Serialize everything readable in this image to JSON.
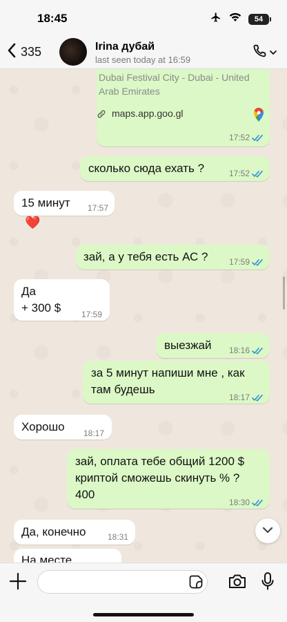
{
  "status_bar": {
    "time": "18:45",
    "battery": "54"
  },
  "header": {
    "back_count": "335",
    "contact_name": "Irina дубай",
    "last_seen": "last seen today at 16:59"
  },
  "location_card": {
    "address": "Dubai Festival City - Dubai - United Arab Emirates",
    "link": "maps.app.goo.gl",
    "time": "17:52",
    "status": "read"
  },
  "messages": [
    {
      "direction": "out",
      "text": "сколько сюда ехать ?",
      "time": "17:52",
      "status": "read"
    },
    {
      "direction": "in",
      "text": "15 минут",
      "time": "17:57"
    },
    {
      "direction": "in",
      "reaction": "❤️"
    },
    {
      "direction": "out",
      "text": "зай, а у тебя есть АС ?",
      "time": "17:59",
      "status": "read"
    },
    {
      "direction": "in",
      "lines": [
        "Да",
        "+ 300 $"
      ],
      "time": "17:59"
    },
    {
      "direction": "out",
      "text": "выезжай",
      "time": "18:16",
      "status": "read"
    },
    {
      "direction": "out",
      "lines": [
        "за 5 минут напиши мне , как",
        "там будешь"
      ],
      "time": "18:17",
      "status": "read"
    },
    {
      "direction": "in",
      "text": "Хорошо",
      "time": "18:17"
    },
    {
      "direction": "out",
      "lines": [
        "зай, оплата тебе общий 1200 $",
        "криптой сможешь скинуть % ?",
        "400"
      ],
      "time": "18:30",
      "status": "read"
    },
    {
      "direction": "in",
      "text": "Да, конечно",
      "time": "18:31"
    },
    {
      "direction": "in",
      "text": "На месте",
      "partial": true
    }
  ],
  "compose": {
    "placeholder": "",
    "value": ""
  },
  "icons": {
    "back": "chevron-left-icon",
    "call": "phone-icon",
    "link": "link-icon",
    "maps": "google-maps-pin-icon",
    "read": "double-check-icon",
    "scroll": "chevron-down-icon",
    "attach": "plus-icon",
    "sticker": "sticker-icon",
    "camera": "camera-icon",
    "mic": "microphone-icon"
  },
  "colors": {
    "outgoing_bubble": "#dbf8c6",
    "incoming_bubble": "#ffffff",
    "read_ticks": "#2f8fd8",
    "chat_background": "#efe7dd"
  }
}
